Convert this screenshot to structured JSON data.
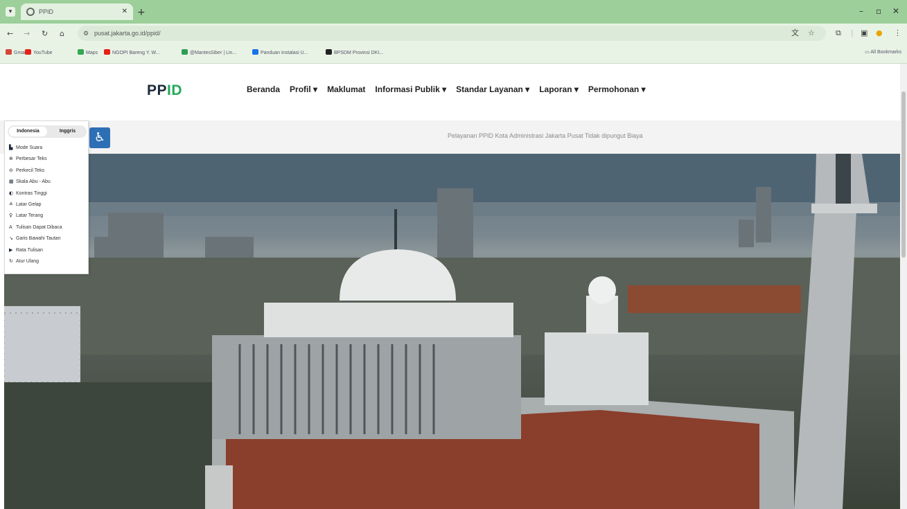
{
  "browser": {
    "tab_title": "PPID",
    "url": "pusat.jakarta.go.id/ppid/",
    "bookmarks": [
      {
        "label": "Gmail",
        "color": "#d44638"
      },
      {
        "label": "YouTube",
        "color": "#e62117"
      },
      {
        "label": "Maps",
        "color": "#34a853"
      },
      {
        "label": "NGOPI Bareng Y. W...",
        "color": "#e62117"
      },
      {
        "label": "@MantesSiber | Lin...",
        "color": "#2e9e57"
      },
      {
        "label": "Panduan Instalasi U...",
        "color": "#1a73e8"
      },
      {
        "label": "BPSDM Provinsi DKI...",
        "color": "#222222"
      }
    ],
    "all_bookmarks": "All Bookmarks"
  },
  "site": {
    "logo_pp": "PP",
    "logo_id": "ID",
    "nav": [
      "Beranda",
      "Profil ▾",
      "Maklumat",
      "Informasi Publik ▾",
      "Standar Layanan ▾",
      "Laporan ▾",
      "Permohonan ▾"
    ],
    "marquee": "Pelayanan PPID Kota Administrasi Jakarta Pusat Tidak dipungut Biaya"
  },
  "accessibility": {
    "lang_active": "Indonesia",
    "lang_other": "Inggris",
    "items": [
      {
        "icon": "▙",
        "label": "Mode Suara"
      },
      {
        "icon": "⊕",
        "label": "Perbesar Teks"
      },
      {
        "icon": "⊖",
        "label": "Perkecil Teks"
      },
      {
        "icon": "▦",
        "label": "Skala Abu - Abu"
      },
      {
        "icon": "◐",
        "label": "Kontras Tinggi"
      },
      {
        "icon": "≗",
        "label": "Latar Gelap"
      },
      {
        "icon": "♀",
        "label": "Latar Terang"
      },
      {
        "icon": "A",
        "label": "Tulisan Dapat Dibaca"
      },
      {
        "icon": "↘",
        "label": "Garis Bawahi Tautan"
      },
      {
        "icon": "▶",
        "label": "Rata Tulisan"
      },
      {
        "icon": "↻",
        "label": "Atur Ulang"
      }
    ]
  },
  "colors": {
    "brand_green": "#22a95a",
    "access_blue": "#2d6fb5",
    "chrome_green": "#9ccf9a"
  }
}
